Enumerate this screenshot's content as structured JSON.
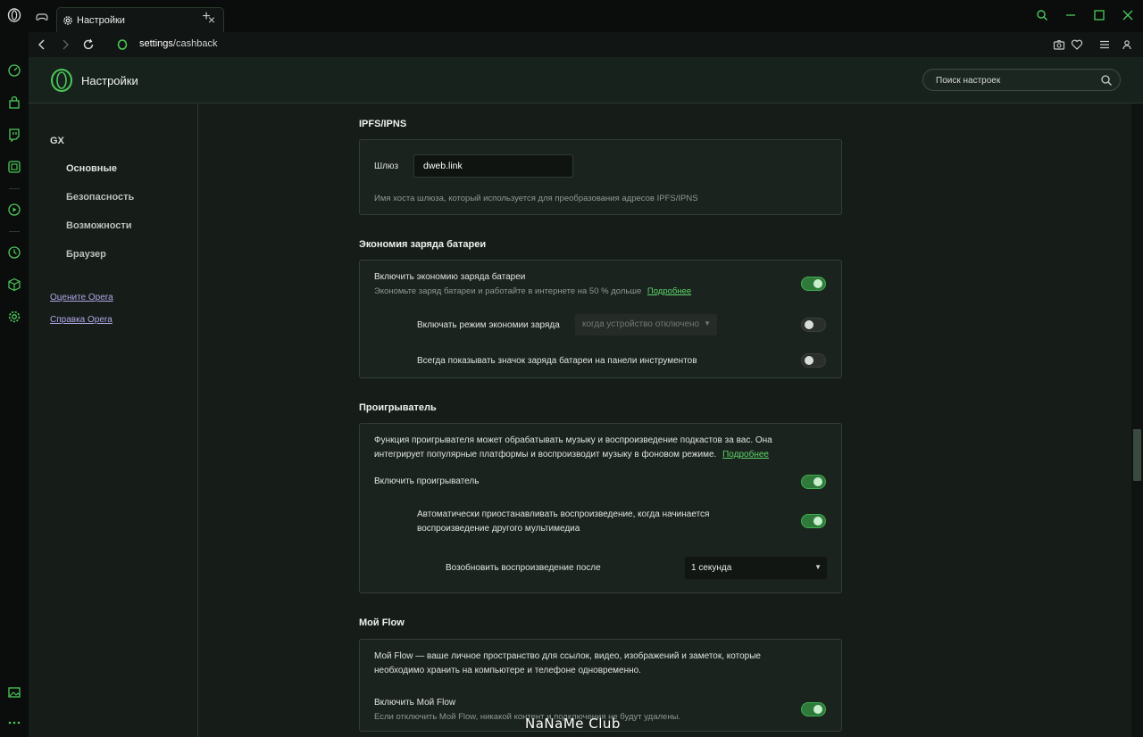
{
  "browser": {
    "tab_title": "Настройки",
    "url_host": "settings",
    "url_path": "/cashback"
  },
  "header": {
    "title": "Настройки",
    "search_placeholder": "Поиск настроек"
  },
  "nav": {
    "group": "GX",
    "items": [
      "Основные",
      "Безопасность",
      "Возможности",
      "Браузер"
    ],
    "links": [
      "Оцените Opera",
      "Справка Opera"
    ]
  },
  "ipfs": {
    "title": "IPFS/IPNS",
    "gateway_label": "Шлюз",
    "gateway_value": "dweb.link",
    "gateway_hint": "Имя хоста шлюза, который используется для преобразования адресов IPFS/IPNS"
  },
  "battery": {
    "title": "Экономия заряда батареи",
    "enable_label": "Включить экономию заряда батареи",
    "enable_hint": "Экономьте заряд батареи и работайте в интернете на 50 % дольше",
    "more_link": "Подробнее",
    "enable_on": true,
    "mode_label": "Включать режим экономии заряда",
    "mode_value": "когда устройство отключено",
    "mode_on": false,
    "icon_label": "Всегда показывать значок заряда батареи на панели инструментов",
    "icon_on": false
  },
  "player": {
    "title": "Проигрыватель",
    "desc_line1": "Функция проигрывателя может обрабатывать музыку и воспроизведение подкастов за вас. Она",
    "desc_line2": "интегрирует популярные платформы и воспроизводит музыку в фоновом режиме.",
    "more_link": "Подробнее",
    "enable_label": "Включить проигрыватель",
    "enable_on": true,
    "autopause_line1": "Автоматически приостанавливать воспроизведение, когда начинается",
    "autopause_line2": "воспроизведение другого мультимедиа",
    "autopause_on": true,
    "resume_label": "Возобновить воспроизведение после",
    "resume_value": "1 секунда"
  },
  "flow": {
    "title": "Мой Flow",
    "desc_line1": "Мой Flow — ваше личное пространство для ссылок, видео, изображений и заметок, которые",
    "desc_line2": "необходимо хранить на компьютере и телефоне одновременно.",
    "enable_label": "Включить Мой Flow",
    "enable_hint": "Если отключить Мой Flow, никакой контент и подключения не будут удалены.",
    "enable_on": true
  },
  "watermark": "NaNaMe Club",
  "colors": {
    "accent": "#5cd66a",
    "toggle_on": "#2f7a3b",
    "background": "#161d19"
  }
}
